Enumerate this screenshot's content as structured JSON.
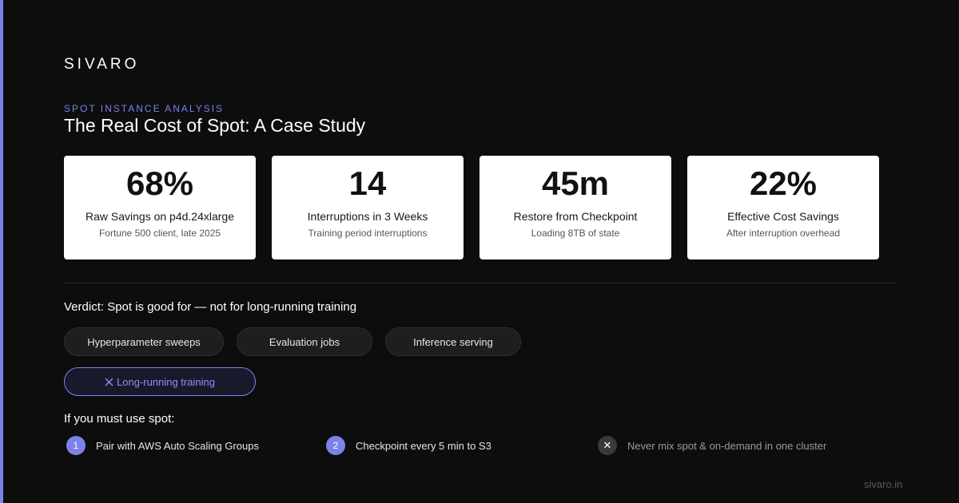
{
  "brand": {
    "logo": "SIVARO",
    "accent": "#7b83eb",
    "footer": "sivaro.in"
  },
  "header": {
    "eyebrow": "SPOT INSTANCE ANALYSIS",
    "title": "The Real Cost of Spot: A Case Study"
  },
  "stats": [
    {
      "value": "68%",
      "label": "Raw Savings on p4d.24xlarge",
      "sub": "Fortune 500 client, late 2025"
    },
    {
      "value": "14",
      "label": "Interruptions in 3 Weeks",
      "sub": "Training period interruptions"
    },
    {
      "value": "45m",
      "label": "Restore from Checkpoint",
      "sub": "Loading 8TB of state"
    },
    {
      "value": "22%",
      "label": "Effective Cost Savings",
      "sub": "After interruption overhead"
    }
  ],
  "verdict": {
    "heading": "Verdict: Spot is good for — not for long-running training",
    "good_for": [
      "Hyperparameter sweeps",
      "Evaluation jobs",
      "Inference serving"
    ],
    "not_for": {
      "icon": "x-icon",
      "label": "Long-running training"
    }
  },
  "guidance": {
    "heading": "If you must use spot:",
    "steps": [
      {
        "badge": "1",
        "text": "Pair with AWS Auto Scaling Groups"
      },
      {
        "badge": "2",
        "text": "Checkpoint every 5 min to S3"
      },
      {
        "badge": "✕",
        "icon": "x-icon",
        "text": "Never mix spot & on-demand in one cluster"
      }
    ]
  }
}
